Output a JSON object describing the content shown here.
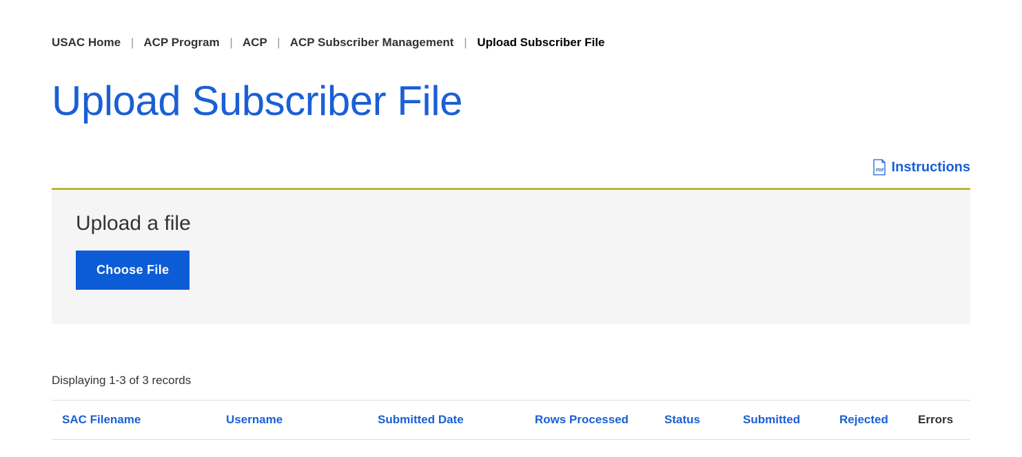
{
  "breadcrumb": {
    "items": [
      {
        "label": "USAC Home"
      },
      {
        "label": "ACP Program"
      },
      {
        "label": "ACP"
      },
      {
        "label": "ACP Subscriber Management"
      }
    ],
    "current": "Upload Subscriber File"
  },
  "page_title": "Upload Subscriber File",
  "instructions_label": "Instructions",
  "upload": {
    "heading": "Upload a file",
    "button": "Choose File"
  },
  "records_display": "Displaying 1-3 of 3 records",
  "table": {
    "columns": [
      {
        "label": "SAC Filename",
        "sortable": true
      },
      {
        "label": "Username",
        "sortable": true
      },
      {
        "label": "Submitted Date",
        "sortable": true
      },
      {
        "label": "Rows Processed",
        "sortable": true
      },
      {
        "label": "Status",
        "sortable": true
      },
      {
        "label": "Submitted",
        "sortable": true
      },
      {
        "label": "Rejected",
        "sortable": true
      },
      {
        "label": "Errors",
        "sortable": false
      }
    ]
  }
}
